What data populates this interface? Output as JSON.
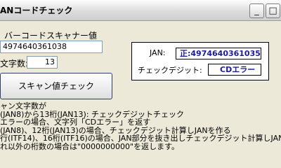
{
  "window": {
    "title": "ANコードチェック",
    "minimize_glyph": "_",
    "maximize_glyph": "□"
  },
  "form": {
    "barcode_label": "バーコードスキャナー値",
    "barcode_value": "4974640361038",
    "length_label": "文字数:",
    "length_value": "13",
    "check_button": "スキャン値チェック"
  },
  "result": {
    "jan_label": "JAN:",
    "jan_value": "正:4974640361035",
    "checkdigit_label": "チェックデジット:",
    "checkdigit_value": "CDエラー"
  },
  "description": [
    "ャン文字数が",
    "(JAN8)から13桁(JAN13): チェックデジットチェック",
    "エラーの場合、文字列「CDエラー」を返す",
    "(JAN8)、12桁(JAN13)の場合、チェックデジット計算しJANを作る",
    "行(ITF14)、16桁(ITF16)の場合、JAN部分を抜き出しチェックデジット計算しJANを",
    "れ以外の桁数の場合は\"0000000000\"を返します。"
  ]
}
